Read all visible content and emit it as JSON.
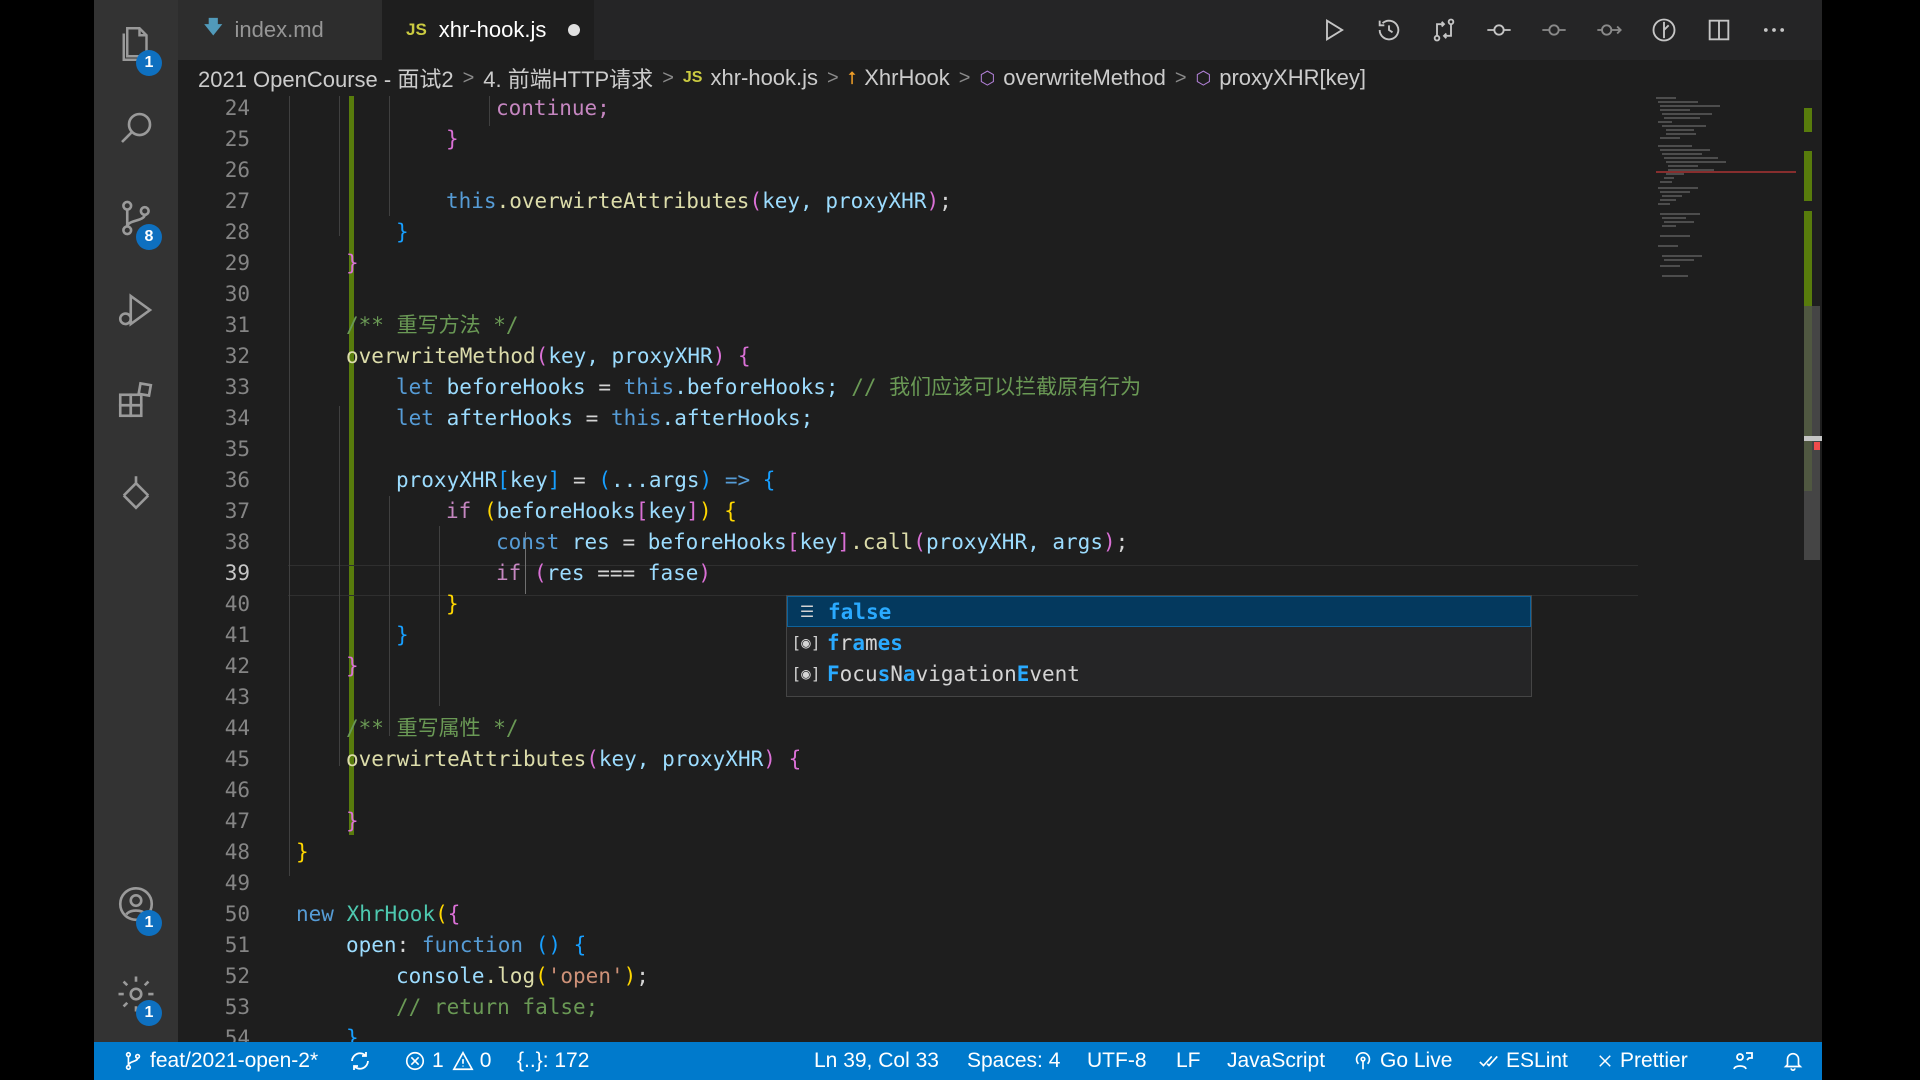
{
  "tabs": [
    {
      "label": "index.md",
      "icon": "markdown-icon"
    },
    {
      "label": "xhr-hook.js",
      "icon": "js-icon",
      "badge": "JS",
      "modified": true
    }
  ],
  "breadcrumb": [
    "2021 OpenCourse - 面试2",
    "4. 前端HTTP请求",
    "xhr-hook.js",
    "XhrHook",
    "overwriteMethod",
    "proxyXHR[key]"
  ],
  "activity_badges": {
    "explorer": "1",
    "source_control": "8",
    "accounts": "1",
    "manage": "1"
  },
  "editor": {
    "line_numbers": [
      "24",
      "25",
      "26",
      "27",
      "28",
      "29",
      "30",
      "31",
      "32",
      "33",
      "34",
      "35",
      "36",
      "37",
      "38",
      "39",
      "40",
      "41",
      "42",
      "43",
      "44",
      "45",
      "46",
      "47",
      "48",
      "49",
      "50",
      "51",
      "52",
      "53",
      "54"
    ],
    "current_line": "39",
    "lines": {
      "l24": "continue;",
      "l27a": "this",
      "l27b": ".overwirteAttributes",
      "l27c": "key, proxyXHR",
      "l31": "/** 重写方法 */",
      "l32a": "overwriteMethod",
      "l32b": "key, proxyXHR",
      "l33a": "let",
      "l33b": "beforeHooks",
      "l33c": "this",
      "l33d": ".beforeHooks;",
      "l33e": "// 我们应该可以拦截原有行为",
      "l34a": "let",
      "l34b": "afterHooks",
      "l34c": "this",
      "l34d": ".afterHooks;",
      "l36a": "proxyXHR",
      "l36b": "key",
      "l36c": "...args",
      "l36d": "=>",
      "l37a": "if",
      "l37b": "beforeHooks",
      "l37c": "key",
      "l38a": "const",
      "l38b": "res",
      "l38c": "beforeHooks",
      "l38d": "key",
      "l38e": ".call",
      "l38f": "proxyXHR, args",
      "l39a": "if",
      "l39b": "res",
      "l39c": "===",
      "l39d": "fase",
      "l44": "/** 重写属性 */",
      "l45a": "overwirteAttributes",
      "l45b": "key, proxyXHR",
      "l50a": "new",
      "l50b": "XhrHook",
      "l51a": "open",
      "l51b": "function",
      "l52a": "console",
      "l52b": ".log",
      "l52c": "'open'",
      "l53": "// return false;"
    }
  },
  "suggestions": [
    {
      "label": "false",
      "highlight": "fa|l|se",
      "kind": "keyword"
    },
    {
      "label": "frames",
      "kind": "variable"
    },
    {
      "label": "FocusNavigationEvent",
      "kind": "variable"
    }
  ],
  "status": {
    "branch": "feat/2021-open-2*",
    "errors": "1",
    "warnings": "0",
    "symbols": "{..}: 172",
    "position": "Ln 39, Col 33",
    "spaces": "Spaces: 4",
    "encoding": "UTF-8",
    "eol": "LF",
    "language": "JavaScript",
    "golive": "Go Live",
    "eslint": "ESLint",
    "prettier": "Prettier"
  },
  "colors": {
    "statusbar": "#007acc",
    "accent": "#0e70c0",
    "gitbar": "#587c0c"
  }
}
